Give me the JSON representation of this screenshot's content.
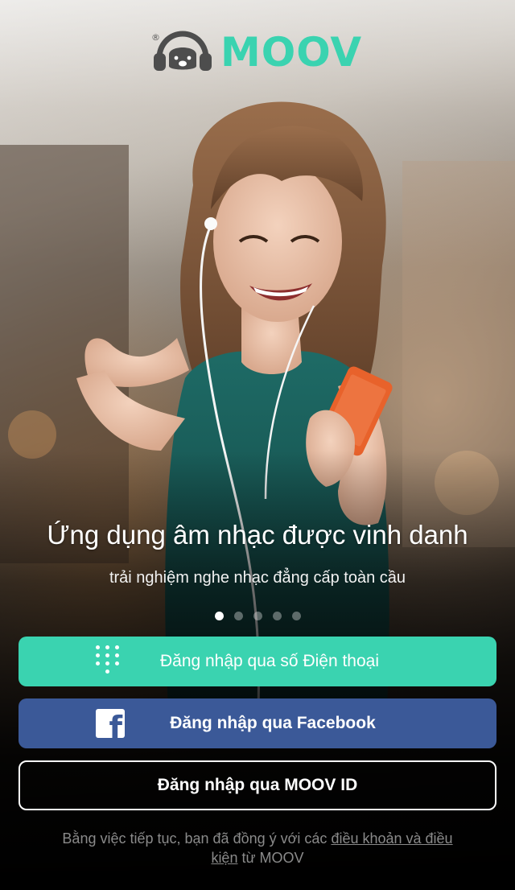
{
  "brand": {
    "name": "MOOV",
    "registered_mark": "®",
    "accent_color": "#3ad3b0"
  },
  "hero": {
    "headline": "Ứng dụng âm nhạc được vinh danh",
    "subline": "trải nghiệm nghe nhạc đẳng cấp toàn cầu",
    "carousel_pages": 5,
    "carousel_active_index": 0
  },
  "buttons": {
    "phone_login": {
      "label": "Đăng nhập qua số Điện thoại",
      "icon": "keypad-icon",
      "color": "#3ad3b0"
    },
    "facebook_login": {
      "label": "Đăng nhập qua Facebook",
      "icon": "facebook-icon",
      "color": "#3b5998"
    },
    "moov_login": {
      "label": "Đăng nhập qua MOOV ID"
    }
  },
  "terms": {
    "prefix": "Bằng việc tiếp tục, bạn đã đồng ý với các",
    "link_part1": "điều khoản và điều",
    "link_part2": "kiện",
    "suffix": "từ MOOV"
  }
}
